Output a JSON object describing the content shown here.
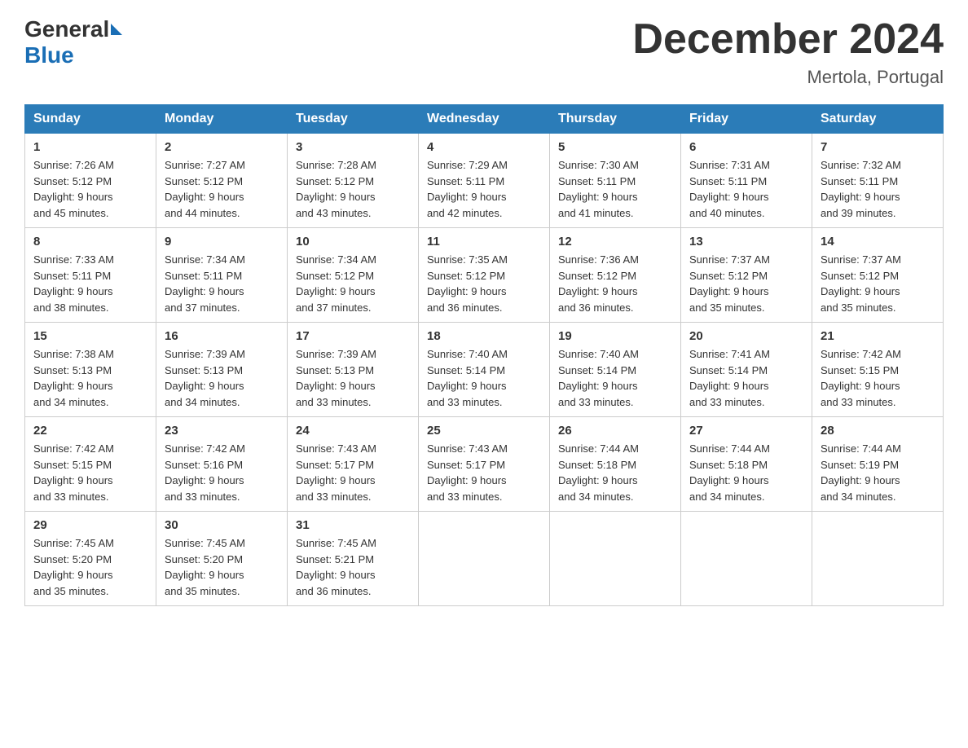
{
  "logo": {
    "text_general": "General",
    "text_blue": "Blue"
  },
  "title": {
    "month_year": "December 2024",
    "location": "Mertola, Portugal"
  },
  "headers": [
    "Sunday",
    "Monday",
    "Tuesday",
    "Wednesday",
    "Thursday",
    "Friday",
    "Saturday"
  ],
  "weeks": [
    [
      {
        "day": "1",
        "sunrise": "7:26 AM",
        "sunset": "5:12 PM",
        "daylight": "9 hours and 45 minutes."
      },
      {
        "day": "2",
        "sunrise": "7:27 AM",
        "sunset": "5:12 PM",
        "daylight": "9 hours and 44 minutes."
      },
      {
        "day": "3",
        "sunrise": "7:28 AM",
        "sunset": "5:12 PM",
        "daylight": "9 hours and 43 minutes."
      },
      {
        "day": "4",
        "sunrise": "7:29 AM",
        "sunset": "5:11 PM",
        "daylight": "9 hours and 42 minutes."
      },
      {
        "day": "5",
        "sunrise": "7:30 AM",
        "sunset": "5:11 PM",
        "daylight": "9 hours and 41 minutes."
      },
      {
        "day": "6",
        "sunrise": "7:31 AM",
        "sunset": "5:11 PM",
        "daylight": "9 hours and 40 minutes."
      },
      {
        "day": "7",
        "sunrise": "7:32 AM",
        "sunset": "5:11 PM",
        "daylight": "9 hours and 39 minutes."
      }
    ],
    [
      {
        "day": "8",
        "sunrise": "7:33 AM",
        "sunset": "5:11 PM",
        "daylight": "9 hours and 38 minutes."
      },
      {
        "day": "9",
        "sunrise": "7:34 AM",
        "sunset": "5:11 PM",
        "daylight": "9 hours and 37 minutes."
      },
      {
        "day": "10",
        "sunrise": "7:34 AM",
        "sunset": "5:12 PM",
        "daylight": "9 hours and 37 minutes."
      },
      {
        "day": "11",
        "sunrise": "7:35 AM",
        "sunset": "5:12 PM",
        "daylight": "9 hours and 36 minutes."
      },
      {
        "day": "12",
        "sunrise": "7:36 AM",
        "sunset": "5:12 PM",
        "daylight": "9 hours and 36 minutes."
      },
      {
        "day": "13",
        "sunrise": "7:37 AM",
        "sunset": "5:12 PM",
        "daylight": "9 hours and 35 minutes."
      },
      {
        "day": "14",
        "sunrise": "7:37 AM",
        "sunset": "5:12 PM",
        "daylight": "9 hours and 35 minutes."
      }
    ],
    [
      {
        "day": "15",
        "sunrise": "7:38 AM",
        "sunset": "5:13 PM",
        "daylight": "9 hours and 34 minutes."
      },
      {
        "day": "16",
        "sunrise": "7:39 AM",
        "sunset": "5:13 PM",
        "daylight": "9 hours and 34 minutes."
      },
      {
        "day": "17",
        "sunrise": "7:39 AM",
        "sunset": "5:13 PM",
        "daylight": "9 hours and 33 minutes."
      },
      {
        "day": "18",
        "sunrise": "7:40 AM",
        "sunset": "5:14 PM",
        "daylight": "9 hours and 33 minutes."
      },
      {
        "day": "19",
        "sunrise": "7:40 AM",
        "sunset": "5:14 PM",
        "daylight": "9 hours and 33 minutes."
      },
      {
        "day": "20",
        "sunrise": "7:41 AM",
        "sunset": "5:14 PM",
        "daylight": "9 hours and 33 minutes."
      },
      {
        "day": "21",
        "sunrise": "7:42 AM",
        "sunset": "5:15 PM",
        "daylight": "9 hours and 33 minutes."
      }
    ],
    [
      {
        "day": "22",
        "sunrise": "7:42 AM",
        "sunset": "5:15 PM",
        "daylight": "9 hours and 33 minutes."
      },
      {
        "day": "23",
        "sunrise": "7:42 AM",
        "sunset": "5:16 PM",
        "daylight": "9 hours and 33 minutes."
      },
      {
        "day": "24",
        "sunrise": "7:43 AM",
        "sunset": "5:17 PM",
        "daylight": "9 hours and 33 minutes."
      },
      {
        "day": "25",
        "sunrise": "7:43 AM",
        "sunset": "5:17 PM",
        "daylight": "9 hours and 33 minutes."
      },
      {
        "day": "26",
        "sunrise": "7:44 AM",
        "sunset": "5:18 PM",
        "daylight": "9 hours and 34 minutes."
      },
      {
        "day": "27",
        "sunrise": "7:44 AM",
        "sunset": "5:18 PM",
        "daylight": "9 hours and 34 minutes."
      },
      {
        "day": "28",
        "sunrise": "7:44 AM",
        "sunset": "5:19 PM",
        "daylight": "9 hours and 34 minutes."
      }
    ],
    [
      {
        "day": "29",
        "sunrise": "7:45 AM",
        "sunset": "5:20 PM",
        "daylight": "9 hours and 35 minutes."
      },
      {
        "day": "30",
        "sunrise": "7:45 AM",
        "sunset": "5:20 PM",
        "daylight": "9 hours and 35 minutes."
      },
      {
        "day": "31",
        "sunrise": "7:45 AM",
        "sunset": "5:21 PM",
        "daylight": "9 hours and 36 minutes."
      },
      null,
      null,
      null,
      null
    ]
  ],
  "labels": {
    "sunrise": "Sunrise:",
    "sunset": "Sunset:",
    "daylight": "Daylight:"
  }
}
